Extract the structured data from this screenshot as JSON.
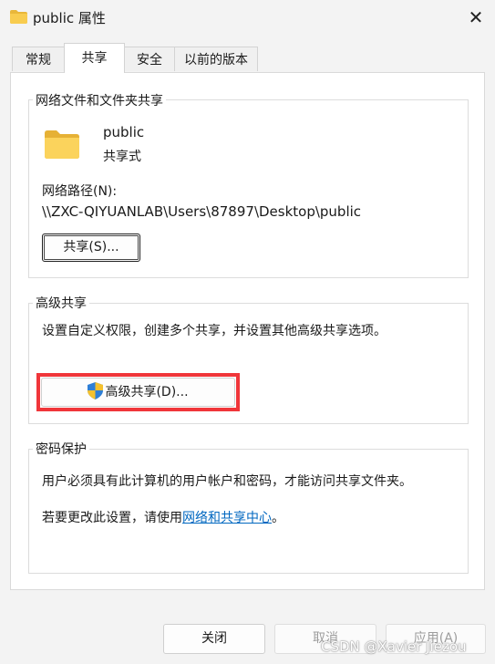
{
  "window": {
    "title": "public 属性",
    "close_symbol": "✕",
    "folder_icon": "folder-icon"
  },
  "tabs": [
    {
      "label": "常规",
      "active": false
    },
    {
      "label": "共享",
      "active": true
    },
    {
      "label": "安全",
      "active": false
    },
    {
      "label": "以前的版本",
      "active": false
    }
  ],
  "network_share": {
    "group_label": "网络文件和文件夹共享",
    "folder_name": "public",
    "share_state": "共享式",
    "path_label": "网络路径(N):",
    "path_value": "\\\\ZXC-QIYUANLAB\\Users\\87897\\Desktop\\public",
    "share_button": "共享(S)..."
  },
  "advanced_share": {
    "group_label": "高级共享",
    "description": "设置自定义权限，创建多个共享，并设置其他高级共享选项。",
    "button": "高级共享(D)...",
    "shield_icon": "uac-shield-icon"
  },
  "password": {
    "group_label": "密码保护",
    "line1": "用户必须具有此计算机的用户帐户和密码，才能访问共享文件夹。",
    "line2_prefix": "若要更改此设置，请使用",
    "line2_link": "网络和共享中心",
    "line2_suffix": "。"
  },
  "footer": {
    "ok": "关闭",
    "cancel": "取消",
    "apply": "应用(A)"
  },
  "watermark": "CSDN @Xavier Jiezou",
  "colors": {
    "highlight_box": "#f0363a",
    "link": "#0067c0",
    "folder": "#f7c948"
  }
}
